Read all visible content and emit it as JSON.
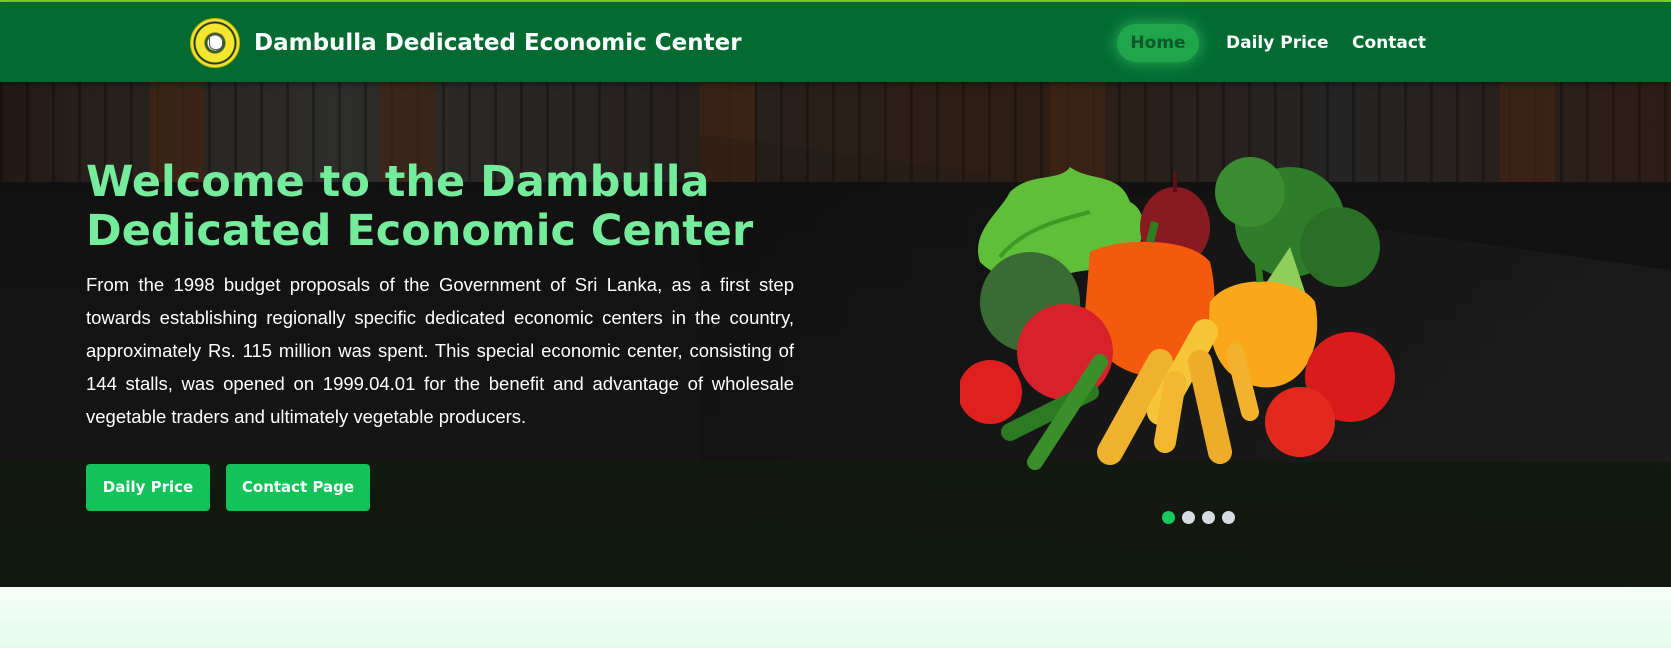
{
  "navbar": {
    "brand": "Dambulla Dedicated Economic Center",
    "items": [
      {
        "label": "Home",
        "active": true
      },
      {
        "label": "Daily Price"
      },
      {
        "label": "Contact"
      }
    ]
  },
  "hero": {
    "title": "Welcome to the Dambulla Dedicated Economic Center",
    "description": "From the 1998 budget proposals of the Government of Sri Lanka, as a first step towards establishing regionally specific dedicated economic centers in the country, approximately Rs. 115 million was spent. This special economic center, consisting of 144 stalls, was opened on 1999.04.01 for the benefit and advantage of wholesale vegetable traders and ultimately vegetable producers.",
    "buttons": {
      "daily_price": "Daily Price",
      "contact_page": "Contact Page"
    },
    "carousel": {
      "slide_count": 4,
      "active_index": 0
    }
  },
  "colors": {
    "navbar": "#036b32",
    "accent": "#13c35a",
    "title": "#74ec9c",
    "topline": "#7ed321"
  },
  "icons": [
    "logo-emblem",
    "vegetables-image"
  ]
}
